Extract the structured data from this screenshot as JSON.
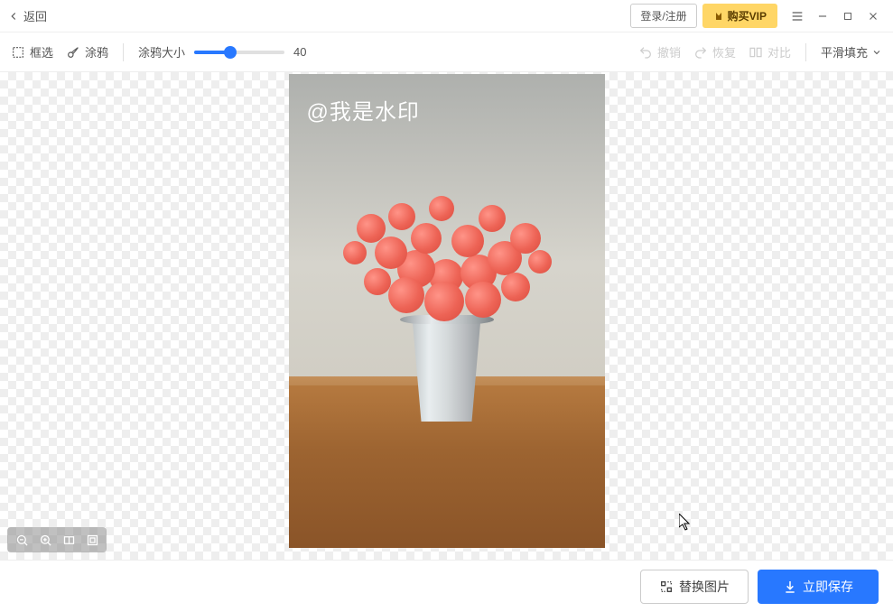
{
  "header": {
    "back_label": "返回",
    "login_label": "登录/注册",
    "vip_label": "购买VIP"
  },
  "toolbar": {
    "box_select_label": "框选",
    "brush_label": "涂鸦",
    "brush_size_label": "涂鸦大小",
    "brush_size_value": "40",
    "undo_label": "撤销",
    "redo_label": "恢复",
    "compare_label": "对比",
    "fill_mode_label": "平滑填充"
  },
  "canvas": {
    "watermark_text": "@我是水印"
  },
  "footer": {
    "replace_label": "替换图片",
    "save_label": "立即保存"
  }
}
